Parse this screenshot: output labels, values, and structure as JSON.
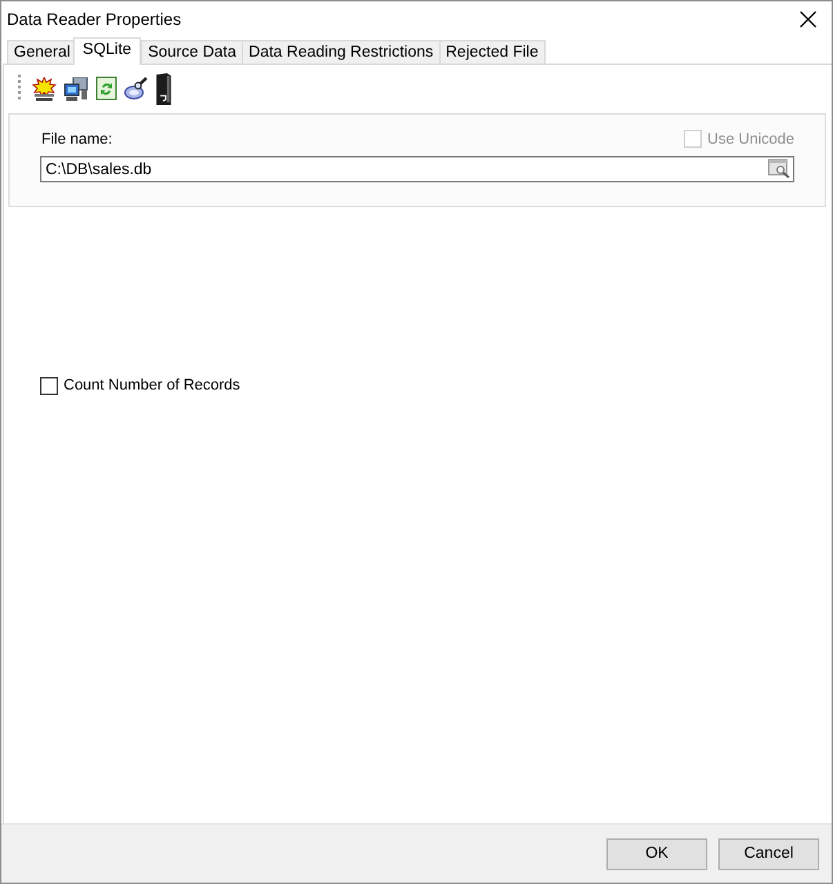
{
  "window": {
    "title": "Data Reader Properties"
  },
  "tabs": [
    {
      "label": "General",
      "selected": false
    },
    {
      "label": "SQLite",
      "selected": true
    },
    {
      "label": "Source Data",
      "selected": false
    },
    {
      "label": "Data Reading Restrictions",
      "selected": false
    },
    {
      "label": "Rejected File",
      "selected": false
    }
  ],
  "file_name": {
    "label": "File name:",
    "value": "C:\\DB\\sales.db"
  },
  "use_unicode": {
    "label": "Use Unicode",
    "checked": false,
    "disabled": true
  },
  "count_records": {
    "label": "Count Number of Records",
    "checked": false,
    "disabled": false
  },
  "buttons": [
    {
      "label": "OK"
    },
    {
      "label": "Cancel"
    }
  ]
}
